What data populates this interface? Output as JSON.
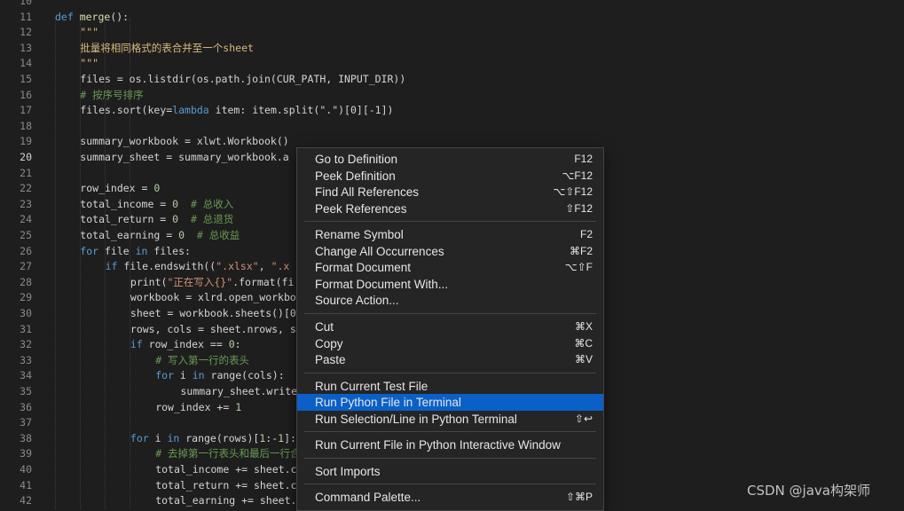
{
  "editor": {
    "lines": [
      {
        "n": "10",
        "cur": false,
        "indent": 0,
        "tokens": []
      },
      {
        "n": "11",
        "cur": false,
        "indent": 0,
        "tokens": [
          {
            "t": "def ",
            "c": "kw"
          },
          {
            "t": "merge",
            "c": "fn"
          },
          {
            "t": "():",
            "c": "plain"
          }
        ]
      },
      {
        "n": "12",
        "cur": false,
        "indent": 1,
        "tokens": [
          {
            "t": "\"\"\"",
            "c": "doc"
          }
        ]
      },
      {
        "n": "13",
        "cur": false,
        "indent": 1,
        "tokens": [
          {
            "t": "批量将相同格式的表合并至一个sheet",
            "c": "doc"
          }
        ]
      },
      {
        "n": "14",
        "cur": false,
        "indent": 1,
        "tokens": [
          {
            "t": "\"\"\"",
            "c": "doc"
          }
        ]
      },
      {
        "n": "15",
        "cur": false,
        "indent": 1,
        "tokens": [
          {
            "t": "files = os.listdir(os.path.join(CUR_PATH, INPUT_DIR))",
            "c": "plain"
          }
        ]
      },
      {
        "n": "16",
        "cur": false,
        "indent": 1,
        "tokens": [
          {
            "t": "# 按序号排序",
            "c": "cmt"
          }
        ]
      },
      {
        "n": "17",
        "cur": false,
        "indent": 1,
        "tokens": [
          {
            "t": "files.sort(",
            "c": "plain"
          },
          {
            "t": "key",
            "c": "plain"
          },
          {
            "t": "=",
            "c": "plain"
          },
          {
            "t": "lambda ",
            "c": "kw"
          },
          {
            "t": "item: item.split(\".\")[0][-1])",
            "c": "plain"
          }
        ]
      },
      {
        "n": "18",
        "cur": false,
        "indent": 0,
        "tokens": []
      },
      {
        "n": "19",
        "cur": false,
        "indent": 1,
        "tokens": [
          {
            "t": "summary_workbook = xlwt.Workbook()",
            "c": "plain"
          }
        ]
      },
      {
        "n": "20",
        "cur": true,
        "indent": 1,
        "tokens": [
          {
            "t": "summary_sheet = summary_workbook.a",
            "c": "plain"
          }
        ]
      },
      {
        "n": "21",
        "cur": false,
        "indent": 0,
        "tokens": []
      },
      {
        "n": "22",
        "cur": false,
        "indent": 1,
        "tokens": [
          {
            "t": "row_index = ",
            "c": "plain"
          },
          {
            "t": "0",
            "c": "num"
          }
        ]
      },
      {
        "n": "23",
        "cur": false,
        "indent": 1,
        "tokens": [
          {
            "t": "total_income = ",
            "c": "plain"
          },
          {
            "t": "0",
            "c": "num"
          },
          {
            "t": "  # 总收入",
            "c": "cmt"
          }
        ]
      },
      {
        "n": "24",
        "cur": false,
        "indent": 1,
        "tokens": [
          {
            "t": "total_return = ",
            "c": "plain"
          },
          {
            "t": "0",
            "c": "num"
          },
          {
            "t": "  # 总退货",
            "c": "cmt"
          }
        ]
      },
      {
        "n": "25",
        "cur": false,
        "indent": 1,
        "tokens": [
          {
            "t": "total_earning = ",
            "c": "plain"
          },
          {
            "t": "0",
            "c": "num"
          },
          {
            "t": "  # 总收益",
            "c": "cmt"
          }
        ]
      },
      {
        "n": "26",
        "cur": false,
        "indent": 1,
        "tokens": [
          {
            "t": "for ",
            "c": "kw"
          },
          {
            "t": "file ",
            "c": "plain"
          },
          {
            "t": "in ",
            "c": "kw"
          },
          {
            "t": "files:",
            "c": "plain"
          }
        ]
      },
      {
        "n": "27",
        "cur": false,
        "indent": 2,
        "tokens": [
          {
            "t": "if ",
            "c": "kw"
          },
          {
            "t": "file.endswith((",
            "c": "plain"
          },
          {
            "t": "\".xlsx\"",
            "c": "str"
          },
          {
            "t": ", ",
            "c": "plain"
          },
          {
            "t": "\".x",
            "c": "str"
          }
        ]
      },
      {
        "n": "28",
        "cur": false,
        "indent": 3,
        "tokens": [
          {
            "t": "print(",
            "c": "plain"
          },
          {
            "t": "\"正在写入{}\"",
            "c": "str"
          },
          {
            "t": ".format(fi",
            "c": "plain"
          }
        ]
      },
      {
        "n": "29",
        "cur": false,
        "indent": 3,
        "tokens": [
          {
            "t": "workbook = xlrd.open_workbo",
            "c": "plain"
          }
        ]
      },
      {
        "n": "30",
        "cur": false,
        "indent": 3,
        "tokens": [
          {
            "t": "sheet = workbook.sheets()[0",
            "c": "plain"
          }
        ]
      },
      {
        "n": "31",
        "cur": false,
        "indent": 3,
        "tokens": [
          {
            "t": "rows, cols = sheet.nrows, s",
            "c": "plain"
          }
        ]
      },
      {
        "n": "32",
        "cur": false,
        "indent": 3,
        "tokens": [
          {
            "t": "if ",
            "c": "kw"
          },
          {
            "t": "row_index == ",
            "c": "plain"
          },
          {
            "t": "0",
            "c": "num"
          },
          {
            "t": ":",
            "c": "plain"
          }
        ]
      },
      {
        "n": "33",
        "cur": false,
        "indent": 4,
        "tokens": [
          {
            "t": "# 写入第一行的表头",
            "c": "cmt"
          }
        ]
      },
      {
        "n": "34",
        "cur": false,
        "indent": 4,
        "tokens": [
          {
            "t": "for ",
            "c": "kw"
          },
          {
            "t": "i ",
            "c": "plain"
          },
          {
            "t": "in ",
            "c": "kw"
          },
          {
            "t": "range(cols):",
            "c": "plain"
          }
        ]
      },
      {
        "n": "35",
        "cur": false,
        "indent": 5,
        "tokens": [
          {
            "t": "summary_sheet.write",
            "c": "plain"
          }
        ]
      },
      {
        "n": "36",
        "cur": false,
        "indent": 4,
        "tokens": [
          {
            "t": "row_index += ",
            "c": "plain"
          },
          {
            "t": "1",
            "c": "num"
          }
        ]
      },
      {
        "n": "37",
        "cur": false,
        "indent": 0,
        "tokens": []
      },
      {
        "n": "38",
        "cur": false,
        "indent": 3,
        "tokens": [
          {
            "t": "for ",
            "c": "kw"
          },
          {
            "t": "i ",
            "c": "plain"
          },
          {
            "t": "in ",
            "c": "kw"
          },
          {
            "t": "range(rows)[",
            "c": "plain"
          },
          {
            "t": "1",
            "c": "num"
          },
          {
            "t": ":-",
            "c": "plain"
          },
          {
            "t": "1",
            "c": "num"
          },
          {
            "t": "]:",
            "c": "plain"
          }
        ]
      },
      {
        "n": "39",
        "cur": false,
        "indent": 4,
        "tokens": [
          {
            "t": "# 去掉第一行表头和最后一行合",
            "c": "cmt"
          }
        ]
      },
      {
        "n": "40",
        "cur": false,
        "indent": 4,
        "tokens": [
          {
            "t": "total_income += sheet.c",
            "c": "plain"
          }
        ]
      },
      {
        "n": "41",
        "cur": false,
        "indent": 4,
        "tokens": [
          {
            "t": "total_return += sheet.c",
            "c": "plain"
          }
        ]
      },
      {
        "n": "42",
        "cur": false,
        "indent": 4,
        "tokens": [
          {
            "t": "total_earning += sheet.",
            "c": "plain"
          }
        ]
      }
    ]
  },
  "context_menu": {
    "items": [
      {
        "label": "Go to Definition",
        "key": "F12",
        "name": "menu-item-go-to-definition"
      },
      {
        "label": "Peek Definition",
        "key": "⌥F12",
        "name": "menu-item-peek-definition"
      },
      {
        "label": "Find All References",
        "key": "⌥⇧F12",
        "name": "menu-item-find-all-references"
      },
      {
        "label": "Peek References",
        "key": "⇧F12",
        "name": "menu-item-peek-references"
      },
      {
        "sep": true
      },
      {
        "label": "Rename Symbol",
        "key": "F2",
        "name": "menu-item-rename-symbol"
      },
      {
        "label": "Change All Occurrences",
        "key": "⌘F2",
        "name": "menu-item-change-all-occurrences"
      },
      {
        "label": "Format Document",
        "key": "⌥⇧F",
        "name": "menu-item-format-document"
      },
      {
        "label": "Format Document With...",
        "key": "",
        "name": "menu-item-format-document-with"
      },
      {
        "label": "Source Action...",
        "key": "",
        "name": "menu-item-source-action"
      },
      {
        "sep": true
      },
      {
        "label": "Cut",
        "key": "⌘X",
        "name": "menu-item-cut"
      },
      {
        "label": "Copy",
        "key": "⌘C",
        "name": "menu-item-copy"
      },
      {
        "label": "Paste",
        "key": "⌘V",
        "name": "menu-item-paste"
      },
      {
        "sep": true
      },
      {
        "label": "Run Current Test File",
        "key": "",
        "name": "menu-item-run-current-test-file"
      },
      {
        "label": "Run Python File in Terminal",
        "key": "",
        "name": "menu-item-run-python-file-in-terminal",
        "active": true
      },
      {
        "label": "Run Selection/Line in Python Terminal",
        "key": "⇧↩",
        "name": "menu-item-run-selection-line"
      },
      {
        "sep": true
      },
      {
        "label": "Run Current File in Python Interactive Window",
        "key": "",
        "name": "menu-item-run-current-file-interactive"
      },
      {
        "sep": true
      },
      {
        "label": "Sort Imports",
        "key": "",
        "name": "menu-item-sort-imports"
      },
      {
        "sep": true
      },
      {
        "label": "Command Palette...",
        "key": "⇧⌘P",
        "name": "menu-item-command-palette"
      }
    ]
  },
  "watermark": "CSDN @java构架师",
  "colors": {
    "menu_bg": "#252526",
    "highlight": "#0a60c7",
    "keyword": "#569cd6",
    "comment": "#6a9955",
    "string": "#ce9178"
  }
}
